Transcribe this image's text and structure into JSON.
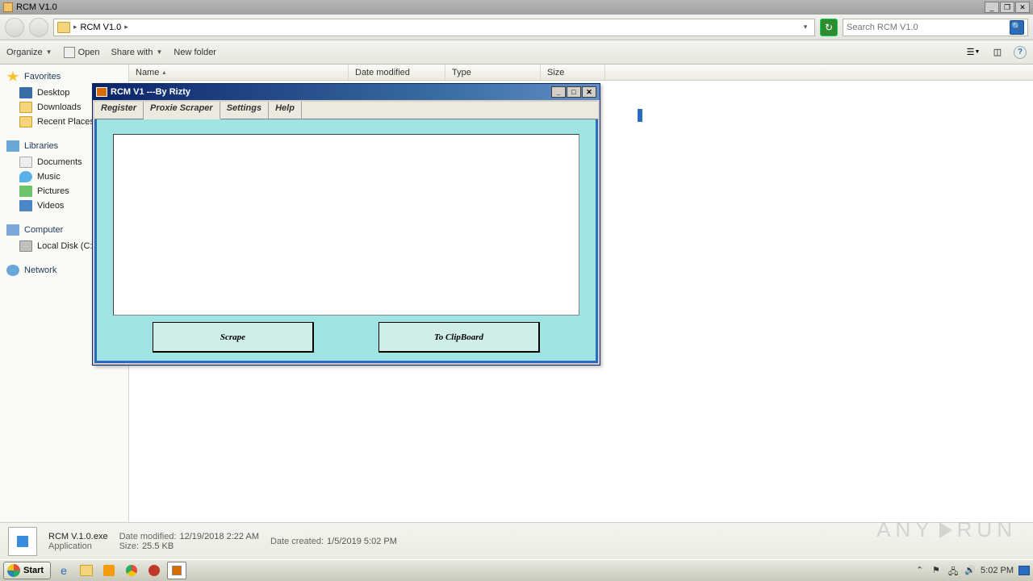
{
  "explorer": {
    "title": "RCM V1.0",
    "breadcrumb": "RCM V1.0",
    "search_placeholder": "Search RCM V1.0",
    "toolbar": {
      "organize": "Organize",
      "open": "Open",
      "share": "Share with",
      "newfolder": "New folder"
    },
    "columns": {
      "name": "Name",
      "modified": "Date modified",
      "type": "Type",
      "size": "Size"
    }
  },
  "sidebar": {
    "favorites": "Favorites",
    "desktop": "Desktop",
    "downloads": "Downloads",
    "recent": "Recent Places",
    "libraries": "Libraries",
    "documents": "Documents",
    "music": "Music",
    "pictures": "Pictures",
    "videos": "Videos",
    "computer": "Computer",
    "localdisk": "Local Disk (C:)",
    "network": "Network"
  },
  "app": {
    "title": "RCM V1 ---By Rizty",
    "tabs": {
      "register": "Register",
      "scraper": "Proxie Scraper",
      "settings": "Settings",
      "help": "Help"
    },
    "buttons": {
      "scrape": "Scrape",
      "clipboard": "To ClipBoard"
    }
  },
  "details": {
    "filename": "RCM V.1.0.exe",
    "filetype": "Application",
    "modified_label": "Date modified:",
    "modified": "12/19/2018 2:22 AM",
    "created_label": "Date created:",
    "created": "1/5/2019 5:02 PM",
    "size_label": "Size:",
    "size": "25.5 KB"
  },
  "taskbar": {
    "start": "Start",
    "time": "5:02 PM"
  },
  "watermark": {
    "a": "ANY",
    "b": "RUN"
  }
}
